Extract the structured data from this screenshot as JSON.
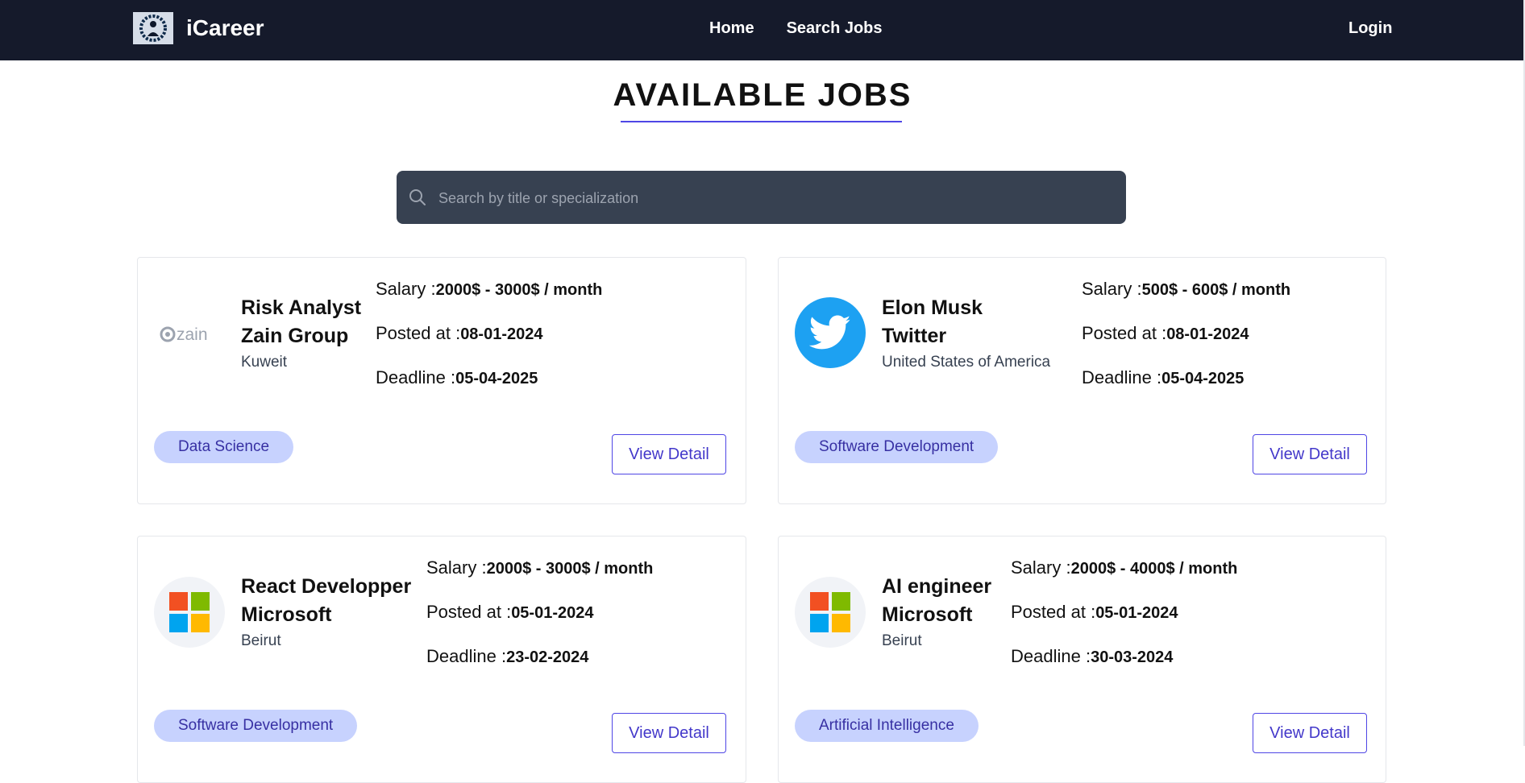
{
  "nav": {
    "brand": "iCareer",
    "links": [
      "Home",
      "Search Jobs"
    ],
    "login": "Login"
  },
  "page": {
    "title": "AVAILABLE JOBS"
  },
  "search": {
    "placeholder": "Search by title or specialization"
  },
  "labels": {
    "salary": "Salary :",
    "posted": "Posted at :",
    "deadline": "Deadline :",
    "view_detail": "View Detail"
  },
  "jobs": [
    {
      "title": "Risk Analyst",
      "company": "Zain Group",
      "location": "Kuweit",
      "logo_text": "zain",
      "logo": "zain-logo",
      "salary": "2000$ - 3000$ / month",
      "posted": "08-01-2024",
      "deadline": "05-04-2025",
      "tag": "Data Science"
    },
    {
      "title": "Elon Musk",
      "company": "Twitter",
      "location": "United States of America",
      "logo": "twitter-logo",
      "salary": "500$ - 600$ / month",
      "posted": "08-01-2024",
      "deadline": "05-04-2025",
      "tag": "Software Development"
    },
    {
      "title": "React Developper",
      "company": "Microsoft",
      "location": "Beirut",
      "logo": "microsoft-logo",
      "salary": "2000$ - 3000$ / month",
      "posted": "05-01-2024",
      "deadline": "23-02-2024",
      "tag": "Software Development"
    },
    {
      "title": "AI engineer",
      "company": "Microsoft",
      "location": "Beirut",
      "logo": "microsoft-logo",
      "salary": "2000$ - 4000$ / month",
      "posted": "05-01-2024",
      "deadline": "30-03-2024",
      "tag": "Artificial Intelligence"
    }
  ],
  "colors": {
    "navbar": "#151a2b",
    "accent": "#4f46e5",
    "tag_bg": "#c7d2fe",
    "search_bg": "#374151",
    "twitter": "#1da1f2"
  }
}
